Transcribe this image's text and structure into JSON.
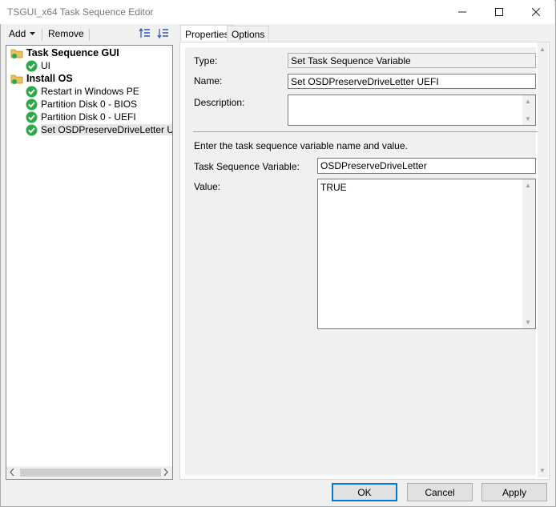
{
  "window": {
    "title": "TSGUI_x64 Task Sequence Editor",
    "minimize_icon": "minimize-icon",
    "maximize_icon": "maximize-icon",
    "close_icon": "close-icon"
  },
  "toolbar": {
    "add_label": "Add",
    "remove_label": "Remove",
    "move_up_icon": "move-up-icon",
    "move_down_icon": "move-down-icon"
  },
  "tree": {
    "groups": [
      {
        "label": "Task Sequence GUI",
        "items": [
          {
            "label": "UI"
          }
        ]
      },
      {
        "label": "Install OS",
        "items": [
          {
            "label": "Restart in Windows PE"
          },
          {
            "label": "Partition Disk 0 - BIOS"
          },
          {
            "label": "Partition Disk 0 - UEFI"
          },
          {
            "label": "Set OSDPreserveDriveLetter UEFI",
            "selected": true
          }
        ]
      }
    ]
  },
  "tabs": [
    {
      "label": "Properties",
      "active": true
    },
    {
      "label": "Options",
      "active": false
    }
  ],
  "properties": {
    "type_label": "Type:",
    "type_value": "Set Task Sequence Variable",
    "name_label": "Name:",
    "name_value": "Set OSDPreserveDriveLetter UEFI",
    "description_label": "Description:",
    "description_value": "",
    "instruction": "Enter the task sequence variable name and value.",
    "variable_label": "Task Sequence Variable:",
    "variable_value": "OSDPreserveDriveLetter",
    "value_label": "Value:",
    "value_value": "TRUE"
  },
  "buttons": {
    "ok": "OK",
    "cancel": "Cancel",
    "apply": "Apply"
  },
  "colors": {
    "accent": "#0078d7",
    "check_green": "#2ea84a",
    "folder_yellow": "#e8c25a"
  }
}
